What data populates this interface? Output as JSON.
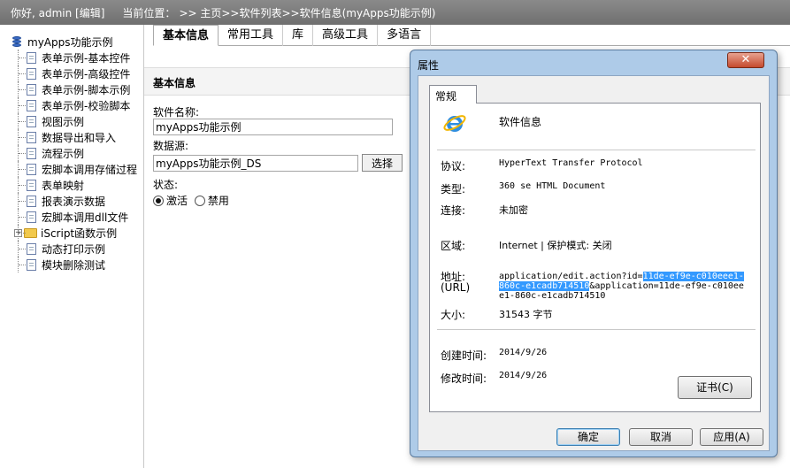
{
  "topbar": {
    "greeting": "你好, admin [编辑]",
    "location_label": "当前位置：",
    "breadcrumb": ">> 主页>>软件列表>>软件信息(myApps功能示例)"
  },
  "tree": {
    "root": "myApps功能示例",
    "items": [
      "表单示例-基本控件",
      "表单示例-高级控件",
      "表单示例-脚本示例",
      "表单示例-校验脚本",
      "视图示例",
      "数据导出和导入",
      "流程示例",
      "宏脚本调用存储过程",
      "表单映射",
      "报表演示数据",
      "宏脚本调用dll文件"
    ],
    "folder": "iScript函数示例",
    "items_after": [
      "动态打印示例",
      "模块删除测试"
    ]
  },
  "tabs": [
    "基本信息",
    "常用工具",
    "库",
    "高级工具",
    "多语言"
  ],
  "section": {
    "title": "基本信息"
  },
  "form": {
    "name_label": "软件名称:",
    "name_value": "myApps功能示例",
    "ds_label": "数据源:",
    "ds_value": "myApps功能示例_DS",
    "select_btn": "选择",
    "status_label": "状态:",
    "status_active": "激活",
    "status_disabled": "禁用"
  },
  "dialog": {
    "title": "属性",
    "close": "✕",
    "tab": "常规",
    "name": "软件信息",
    "protocol_label": "协议:",
    "protocol_value": "HyperText Transfer Protocol",
    "type_label": "类型:",
    "type_value": "360 se HTML Document",
    "conn_label": "连接:",
    "conn_value": "未加密",
    "zone_label": "区域:",
    "zone_value": "Internet | 保护模式: 关闭",
    "address_label": "地址:",
    "address_label2": "(URL)",
    "url_pre": "application/edit.action?id=",
    "url_hl": "11de-ef9e-c010eee1-860c-e1cadb714510",
    "url_post": "&application=11de-ef9e-c010eee1-860c-e1cadb714510",
    "size_label": "大小:",
    "size_value": "31543 字节",
    "created_label": "创建时间:",
    "created_value": "2014/9/26",
    "modified_label": "修改时间:",
    "modified_value": "2014/9/26",
    "cert_btn": "证书(C)",
    "ok_btn": "确定",
    "cancel_btn": "取消",
    "apply_btn": "应用(A)"
  }
}
